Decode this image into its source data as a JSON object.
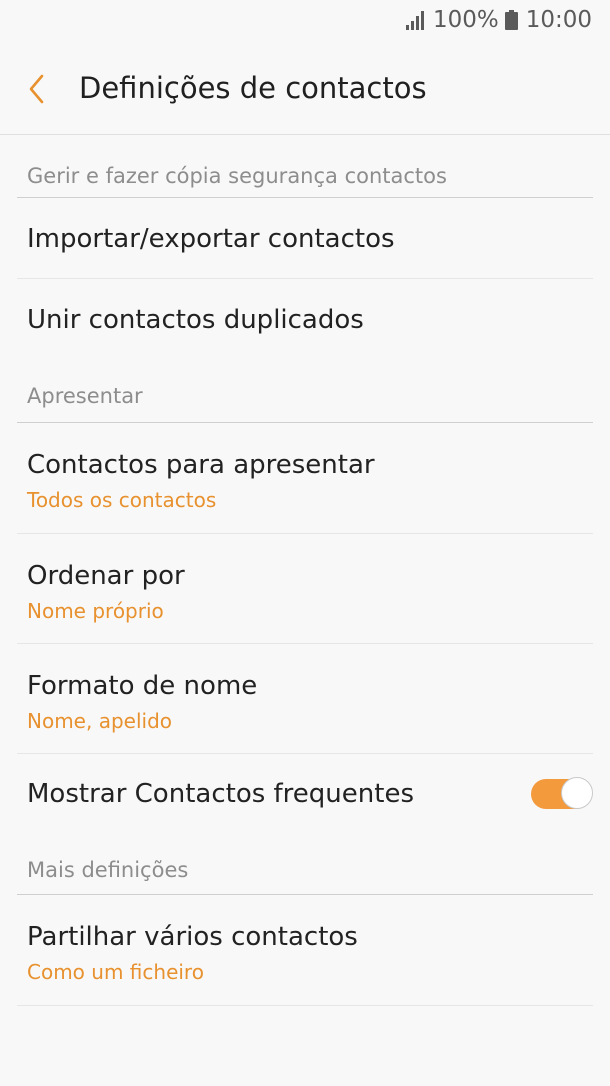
{
  "status_bar": {
    "battery": "100%",
    "time": "10:00"
  },
  "header": {
    "title": "Definições de contactos"
  },
  "sections": [
    {
      "title": "Gerir e fazer cópia segurança contactos",
      "items": [
        {
          "title": "Importar/exportar contactos"
        },
        {
          "title": "Unir contactos duplicados"
        }
      ]
    },
    {
      "title": "Apresentar",
      "items": [
        {
          "title": "Contactos para apresentar",
          "subtitle": "Todos os contactos"
        },
        {
          "title": "Ordenar por",
          "subtitle": "Nome próprio"
        },
        {
          "title": "Formato de nome",
          "subtitle": "Nome, apelido"
        },
        {
          "title": "Mostrar Contactos frequentes",
          "toggle_on": true
        }
      ]
    },
    {
      "title": "Mais definições",
      "items": [
        {
          "title": "Partilhar vários contactos",
          "subtitle": "Como um ficheiro"
        }
      ]
    }
  ],
  "colors": {
    "accent": "#e8912f",
    "toggle_on": "#f39a3d",
    "background": "#f8f8f8"
  },
  "icons": {
    "back": "chevron-left-icon",
    "signal": "signal-icon",
    "battery": "battery-icon"
  }
}
